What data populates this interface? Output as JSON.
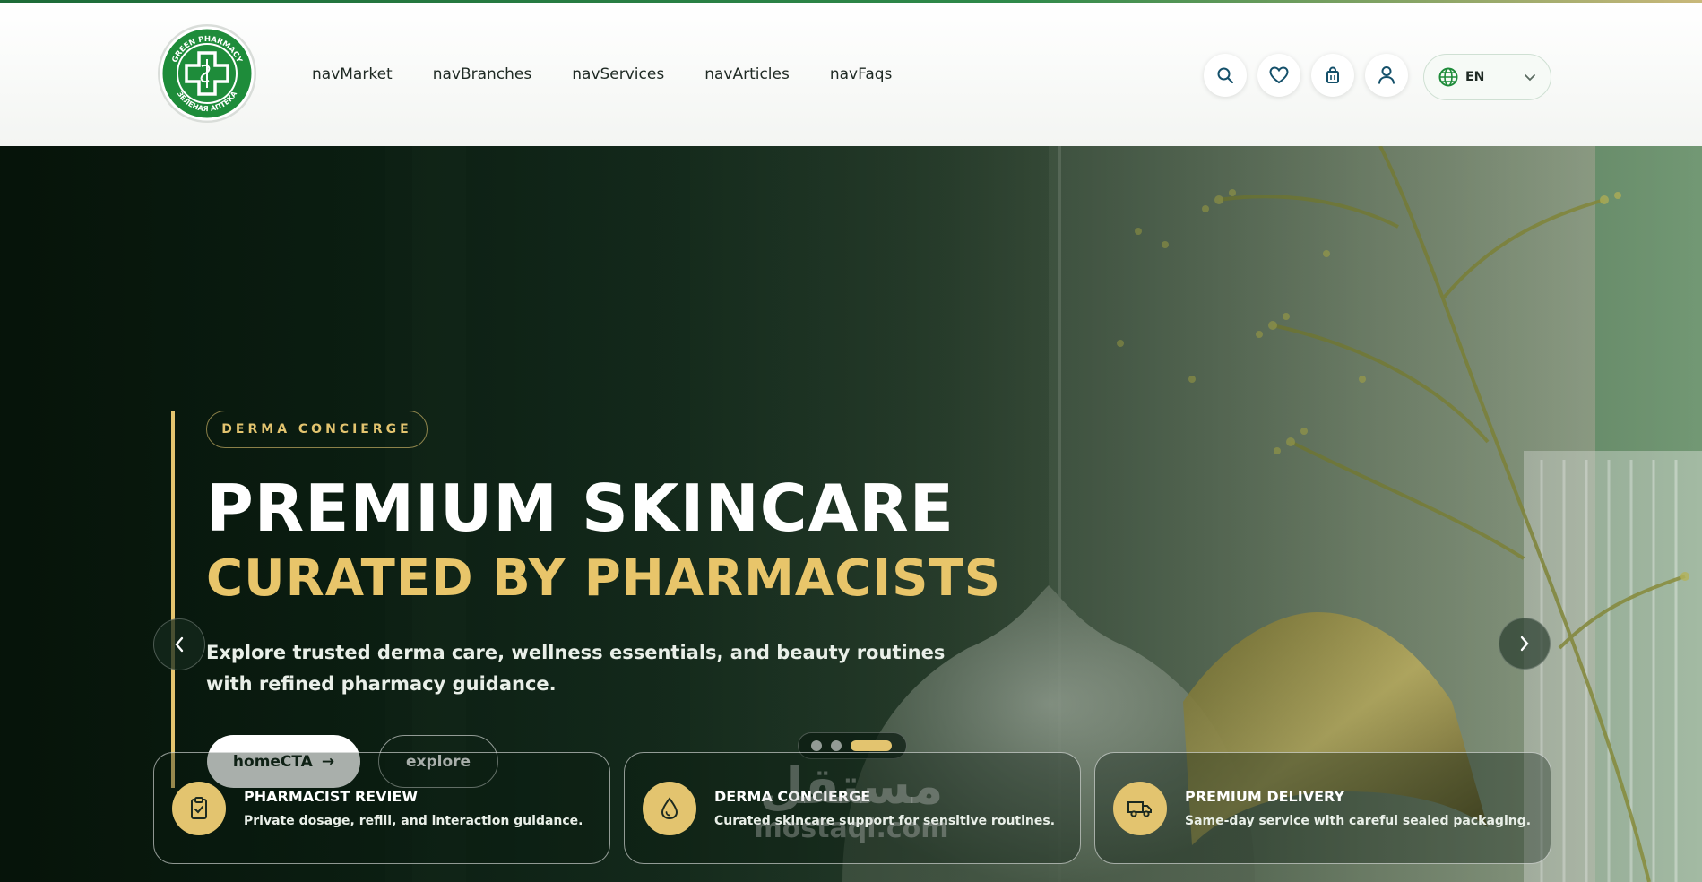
{
  "brand": {
    "logo_text_top": "GREEN PHARMACY",
    "logo_text_bottom": "ЗЕЛЕНАЯ АПТЕКА",
    "colors": {
      "green": "#1e8c3a",
      "gold": "#e3c46f",
      "dark": "#0d1f15"
    }
  },
  "nav": {
    "items": [
      {
        "label": "navMarket"
      },
      {
        "label": "navBranches"
      },
      {
        "label": "navServices"
      },
      {
        "label": "navArticles"
      },
      {
        "label": "navFaqs"
      }
    ]
  },
  "header_icons": [
    "search-icon",
    "heart-icon",
    "bag-icon",
    "user-icon"
  ],
  "language": {
    "code": "EN",
    "icon": "globe-icon"
  },
  "hero": {
    "badge": "DERMA CONCIERGE",
    "title": "PREMIUM SKINCARE",
    "subtitle": "CURATED BY PHARMACISTS",
    "description": "Explore trusted derma care, wellness essentials, and beauty routines with refined pharmacy guidance.",
    "cta_primary": "homeCTA",
    "cta_primary_arrow": "→",
    "cta_secondary": "explore",
    "slides_total": 3,
    "active_slide": 3
  },
  "features": [
    {
      "icon": "clipboard-check-icon",
      "title": "PHARMACIST REVIEW",
      "text": "Private dosage, refill, and interaction guidance."
    },
    {
      "icon": "droplet-icon",
      "title": "DERMA CONCIERGE",
      "text": "Curated skincare support for sensitive routines."
    },
    {
      "icon": "truck-icon",
      "title": "PREMIUM DELIVERY",
      "text": "Same-day service with careful sealed packaging."
    }
  ],
  "watermark": {
    "arabic": "مستقل",
    "latin": "mostaql.com"
  }
}
